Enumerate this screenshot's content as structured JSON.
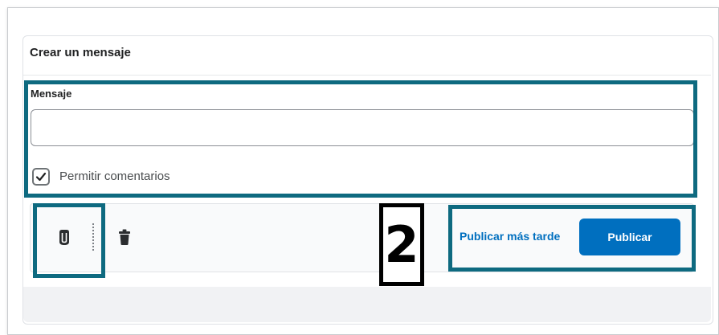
{
  "composer": {
    "title": "Crear un mensaje",
    "message_label": "Mensaje",
    "message_value": "",
    "allow_comments_label": "Permitir comentarios",
    "allow_comments_checked": true
  },
  "toolbar": {
    "attach_icon": "paperclip-icon",
    "delete_icon": "trash-icon",
    "step_number": "2",
    "publish_later_label": "Publicar más tarde",
    "publish_label": "Publicar"
  },
  "colors": {
    "highlight": "#0e6a80",
    "primary": "#006fbf",
    "step_border": "#000000"
  }
}
